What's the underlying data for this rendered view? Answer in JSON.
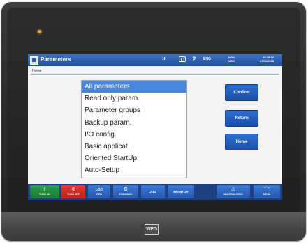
{
  "device": {
    "brand_logo": "WEG"
  },
  "titlebar": {
    "title": "Parameters",
    "status_1": "1H",
    "help": "?",
    "language": "ENG",
    "status_line_1": "100%",
    "status_line_2": "MBS",
    "clock_line_1": "08:28:52",
    "clock_line_2": "27/01/2018"
  },
  "breadcrumb": "Home",
  "menu": {
    "items": [
      "All parameters",
      "Read only param.",
      "Parameter groups",
      "Backup param.",
      "I/O config.",
      "Basic applicat.",
      "Oriented StartUp",
      "Auto-Setup"
    ],
    "selected_index": 0
  },
  "side_buttons": {
    "confirm": "Confirm",
    "return": "Return",
    "home": "Home"
  },
  "footer": {
    "turn_on": {
      "icon": "I",
      "label": "TURN ON"
    },
    "turn_off": {
      "icon": "0",
      "label": "TURN OFF"
    },
    "loc_rem": {
      "icon": "LOC",
      "label": "REM"
    },
    "forward": {
      "icon": "C",
      "label": "FORWARD"
    },
    "jog": {
      "label": "JOG"
    },
    "monitor": {
      "label": "MONITOR"
    },
    "multi_monitor": {
      "icon": "⚠",
      "label": "MULTIVALORES"
    },
    "menu": {
      "icon": "⌒",
      "label": "MENU"
    }
  },
  "colors": {
    "accent_blue": "#2459ae",
    "selection_blue": "#4a86dc",
    "turn_on_green": "#27a04a",
    "turn_off_red": "#e53a2a"
  }
}
